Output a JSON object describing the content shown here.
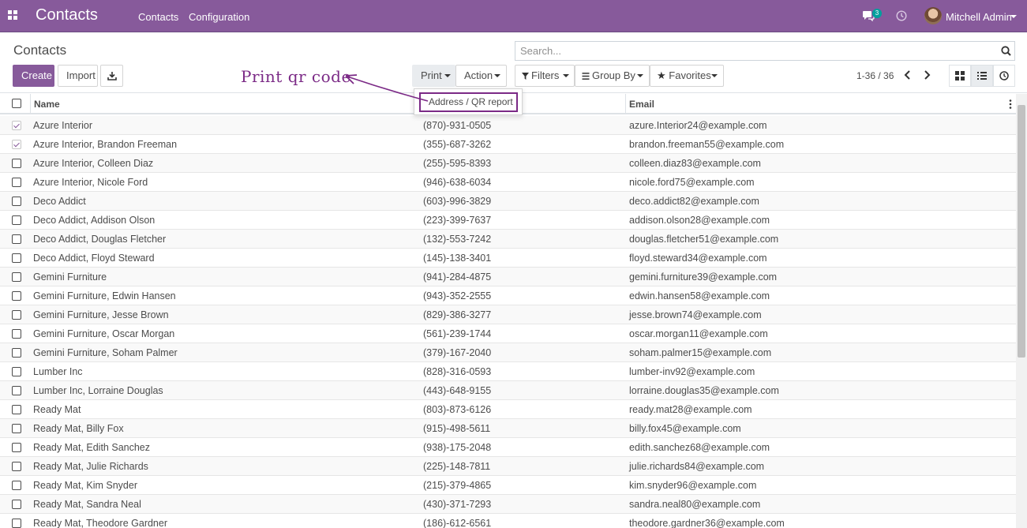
{
  "navbar": {
    "app_title": "Contacts",
    "menu": [
      "Contacts",
      "Configuration"
    ],
    "chat_badge": "3",
    "user_name": "Mitchell Admin"
  },
  "control_panel": {
    "breadcrumb": "Contacts",
    "create_label": "Create",
    "import_label": "Import",
    "print_label": "Print",
    "action_label": "Action",
    "search_placeholder": "Search...",
    "filters_label": "Filters",
    "groupby_label": "Group By",
    "favorites_label": "Favorites",
    "pager_value": "1-36 / 36"
  },
  "print_menu": {
    "items": [
      "Address / QR report"
    ]
  },
  "annotation": {
    "text": "Print qr code"
  },
  "table": {
    "columns": [
      "Name",
      "Email"
    ],
    "rows": [
      {
        "name": "Azure Interior",
        "phone": "(870)-931-0505",
        "email": "azure.Interior24@example.com",
        "checked": true
      },
      {
        "name": "Azure Interior, Brandon Freeman",
        "phone": "(355)-687-3262",
        "email": "brandon.freeman55@example.com",
        "checked": true
      },
      {
        "name": "Azure Interior, Colleen Diaz",
        "phone": "(255)-595-8393",
        "email": "colleen.diaz83@example.com",
        "checked": false
      },
      {
        "name": "Azure Interior, Nicole Ford",
        "phone": "(946)-638-6034",
        "email": "nicole.ford75@example.com",
        "checked": false
      },
      {
        "name": "Deco Addict",
        "phone": "(603)-996-3829",
        "email": "deco.addict82@example.com",
        "checked": false
      },
      {
        "name": "Deco Addict, Addison Olson",
        "phone": "(223)-399-7637",
        "email": "addison.olson28@example.com",
        "checked": false
      },
      {
        "name": "Deco Addict, Douglas Fletcher",
        "phone": "(132)-553-7242",
        "email": "douglas.fletcher51@example.com",
        "checked": false
      },
      {
        "name": "Deco Addict, Floyd Steward",
        "phone": "(145)-138-3401",
        "email": "floyd.steward34@example.com",
        "checked": false
      },
      {
        "name": "Gemini Furniture",
        "phone": "(941)-284-4875",
        "email": "gemini.furniture39@example.com",
        "checked": false
      },
      {
        "name": "Gemini Furniture, Edwin Hansen",
        "phone": "(943)-352-2555",
        "email": "edwin.hansen58@example.com",
        "checked": false
      },
      {
        "name": "Gemini Furniture, Jesse Brown",
        "phone": "(829)-386-3277",
        "email": "jesse.brown74@example.com",
        "checked": false
      },
      {
        "name": "Gemini Furniture, Oscar Morgan",
        "phone": "(561)-239-1744",
        "email": "oscar.morgan11@example.com",
        "checked": false
      },
      {
        "name": "Gemini Furniture, Soham Palmer",
        "phone": "(379)-167-2040",
        "email": "soham.palmer15@example.com",
        "checked": false
      },
      {
        "name": "Lumber Inc",
        "phone": "(828)-316-0593",
        "email": "lumber-inv92@example.com",
        "checked": false
      },
      {
        "name": "Lumber Inc, Lorraine Douglas",
        "phone": "(443)-648-9155",
        "email": "lorraine.douglas35@example.com",
        "checked": false
      },
      {
        "name": "Ready Mat",
        "phone": "(803)-873-6126",
        "email": "ready.mat28@example.com",
        "checked": false
      },
      {
        "name": "Ready Mat, Billy Fox",
        "phone": "(915)-498-5611",
        "email": "billy.fox45@example.com",
        "checked": false
      },
      {
        "name": "Ready Mat, Edith Sanchez",
        "phone": "(938)-175-2048",
        "email": "edith.sanchez68@example.com",
        "checked": false
      },
      {
        "name": "Ready Mat, Julie Richards",
        "phone": "(225)-148-7811",
        "email": "julie.richards84@example.com",
        "checked": false
      },
      {
        "name": "Ready Mat, Kim Snyder",
        "phone": "(215)-379-4865",
        "email": "kim.snyder96@example.com",
        "checked": false
      },
      {
        "name": "Ready Mat, Sandra Neal",
        "phone": "(430)-371-7293",
        "email": "sandra.neal80@example.com",
        "checked": false
      },
      {
        "name": "Ready Mat, Theodore Gardner",
        "phone": "(186)-612-6561",
        "email": "theodore.gardner36@example.com",
        "checked": false
      }
    ]
  },
  "colors": {
    "brand": "#875a9b",
    "annotation": "#7b2a86"
  },
  "icons": [
    "apps-icon",
    "chat-icon",
    "clock-icon",
    "download-icon",
    "filter-icon",
    "list-icon",
    "star-icon",
    "search-icon",
    "chevron-left-icon",
    "chevron-right-icon",
    "kanban-icon",
    "activity-icon"
  ]
}
